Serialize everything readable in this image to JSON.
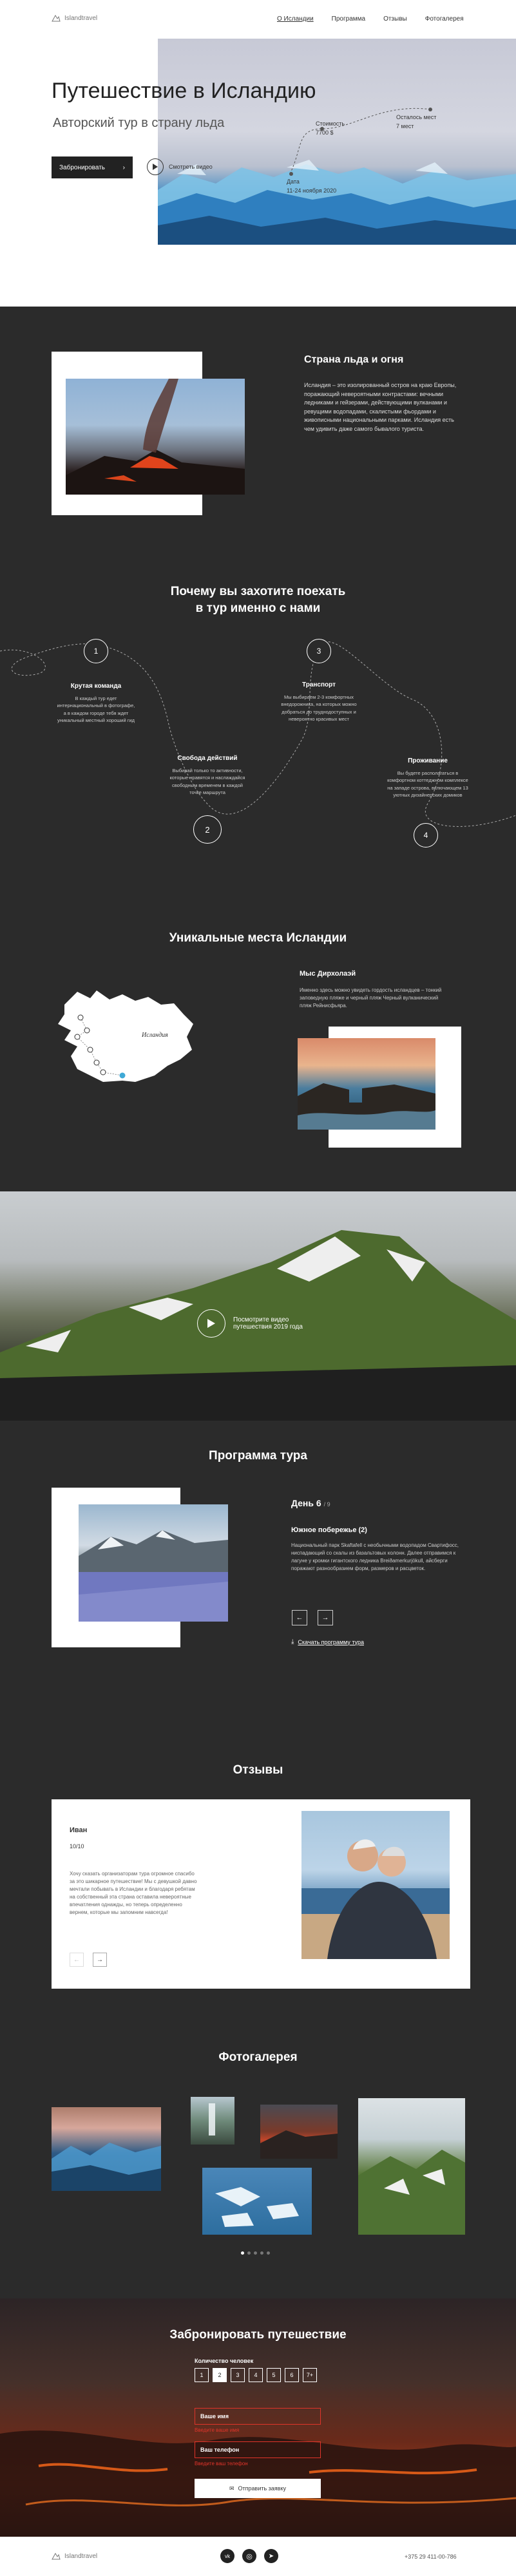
{
  "header": {
    "logo": "Islandtravel",
    "nav": [
      "О Исландии",
      "Программа",
      "Отзывы",
      "Фотогалерея"
    ]
  },
  "hero": {
    "title": "Путешествие в Исландию",
    "subtitle": "Авторский тур в страну льда",
    "book_label": "Забронировать",
    "video_label": "Смотреть видео",
    "price_label": "Стоимость",
    "price_value": "7700 $",
    "seats_label": "Осталось мест",
    "seats_value": "7 мест",
    "date_label": "Дата",
    "date_value": "11-24 ноября 2020"
  },
  "about": {
    "title": "Страна льда и огня",
    "text": "Исландия – это изолированный остров на краю Европы, поражающий невероятными контрастами: вечными ледниками и гейзерами, действующими вулканами и ревущими водопадами, скалистыми фьордами и живописными национальными парками. Исландия есть чем удивить даже самого бывалого туриста."
  },
  "why": {
    "title_line1": "Почему вы захотите поехать",
    "title_line2": "в тур именно с нами",
    "items": [
      {
        "num": "1",
        "title": "Крутая команда",
        "text": "В каждый тур едет интернациональный в фотографе, а в каждом городе тебя ждет уникальный местный хороший гид"
      },
      {
        "num": "2",
        "title": "Свобода действий",
        "text": "Выбирай только то активности, которые нравятся и наслаждайся свободным временем в каждой точке маршрута"
      },
      {
        "num": "3",
        "title": "Транспорт",
        "text": "Мы выбираем 2-3 комфортных внедорожника, на которых можно добраться до труднодоступных и невероятно красивых мест"
      },
      {
        "num": "4",
        "title": "Проживание",
        "text": "Вы будете располагаться в комфортном коттеджном комплексе на западе острова, включающем 13 уютных дизайнерских домиков"
      }
    ]
  },
  "places": {
    "title": "Уникальные места Исландии",
    "map_label": "Исландия",
    "place_title": "Мыс Дирхолаэй",
    "place_text": "Именно здесь можно увидеть гордость исландцев – тонкий заповедную пляже и черный пляж Черный вулканический пляж Рейнисфьяра."
  },
  "video": {
    "caption_line1": "Посмотрите видео",
    "caption_line2": "путешествия 2019 года"
  },
  "program": {
    "title": "Программа тура",
    "day_label": "День 6",
    "day_total": "/ 9",
    "day_title": "Южное побережье (2)",
    "day_text": "Национальный парк Skaftafell с необычными водопадом Свартифосс, ниспадающий со скалы из базальтовых колонн. Далее отправимся к лагуне у кромки гигантского ледника Breiðamerkurjökull, айсберги поражают разнообразием форм, размеров и расцветок.",
    "download_label": "Скачать программу тура"
  },
  "reviews": {
    "title": "Отзывы",
    "name": "Иван",
    "score": "10/10",
    "text": "Хочу сказать организаторам тура огромное спасибо за это шикарное путешествие! Мы с девушкой давно мечтали побывать в Исландии и благодаря ребятам на собственный эта страна оставила невероятные впечатления однажды, но теперь определенно вернем, которые мы запомним навсегда!"
  },
  "gallery": {
    "title": "Фотогалерея"
  },
  "booking": {
    "title": "Забронировать путешествие",
    "count_label": "Количество человек",
    "counts": [
      "1",
      "2",
      "3",
      "4",
      "5",
      "6",
      "7+"
    ],
    "name_placeholder": "Ваше имя",
    "name_error": "Введите ваше имя",
    "phone_placeholder": "Ваш телефон",
    "phone_error": "Введите ваш телефон",
    "submit_label": "Отправить заявку"
  },
  "footer": {
    "logo": "Islandtravel",
    "phone": "+375 29 411-00-786"
  },
  "colors": {
    "dark": "#2b2b2b",
    "accent_red": "#c0392b",
    "ice_blue": "#5aa9d6"
  }
}
